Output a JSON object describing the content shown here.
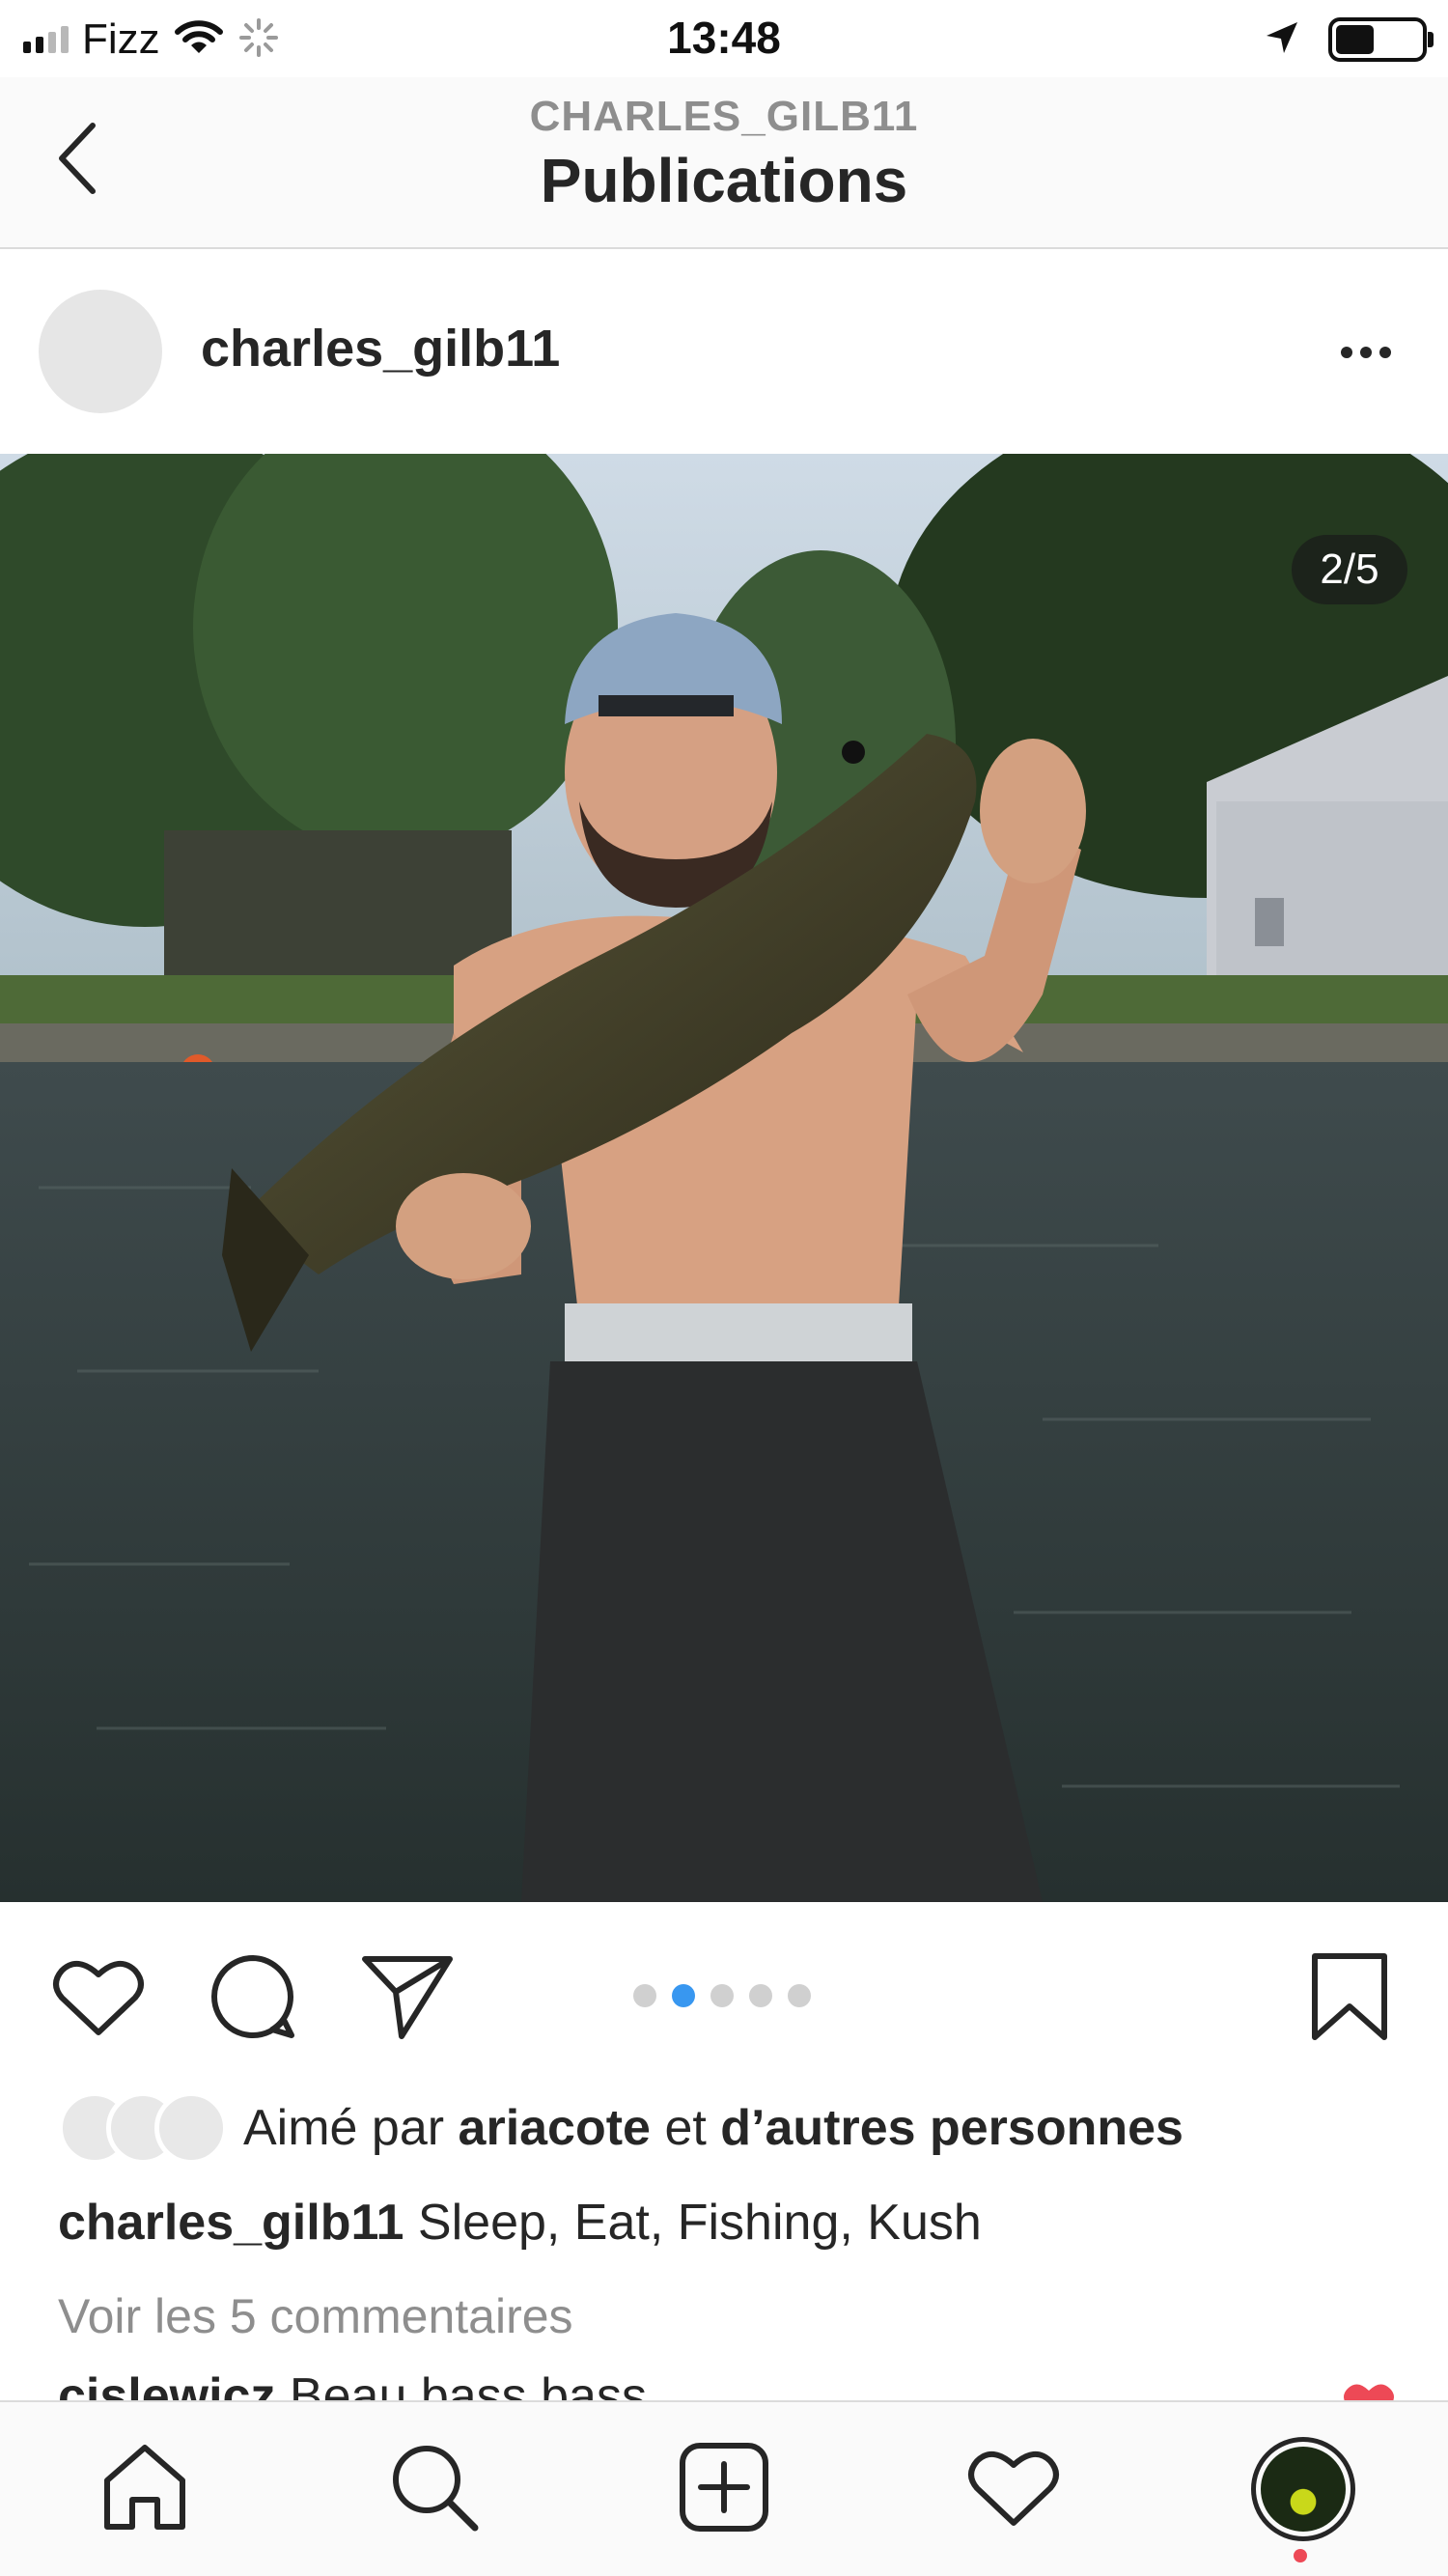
{
  "status_bar": {
    "carrier": "Fizz",
    "time": "13:48",
    "icons": [
      "signal-icon",
      "wifi-icon",
      "loading-spinner-icon",
      "location-arrow-icon",
      "battery-icon"
    ],
    "battery_level": 0.45
  },
  "header": {
    "username_caps": "CHARLES_GILB11",
    "title": "Publications",
    "back_icon": "chevron-left-icon"
  },
  "post": {
    "username": "charles_gilb11",
    "more_icon": "more-horizontal-icon",
    "image_counter": "2/5",
    "carousel": {
      "total": 5,
      "active_index": 2
    },
    "likes": {
      "prefix": "Aimé par",
      "user": "ariacote",
      "joiner": "et",
      "others": "d’autres personnes"
    },
    "caption": {
      "username": "charles_gilb11",
      "text": "Sleep, Eat, Fishing, Kush"
    },
    "view_comments": "Voir les 5 commentaires",
    "comment_preview": {
      "username": "cjslewicz",
      "text": "Beau bass bass"
    }
  },
  "actions": {
    "like_icon": "heart-outline-icon",
    "comment_icon": "comment-bubble-icon",
    "share_icon": "paper-plane-icon",
    "save_icon": "bookmark-icon"
  },
  "tab_bar": {
    "items": [
      "home-icon",
      "search-icon",
      "new-post-icon",
      "activity-heart-icon",
      "profile-avatar"
    ]
  },
  "colors": {
    "accent_blue": "#3897f0",
    "notification_red": "#ed4956",
    "text_primary": "#262626",
    "text_secondary": "#8e8e8e"
  }
}
